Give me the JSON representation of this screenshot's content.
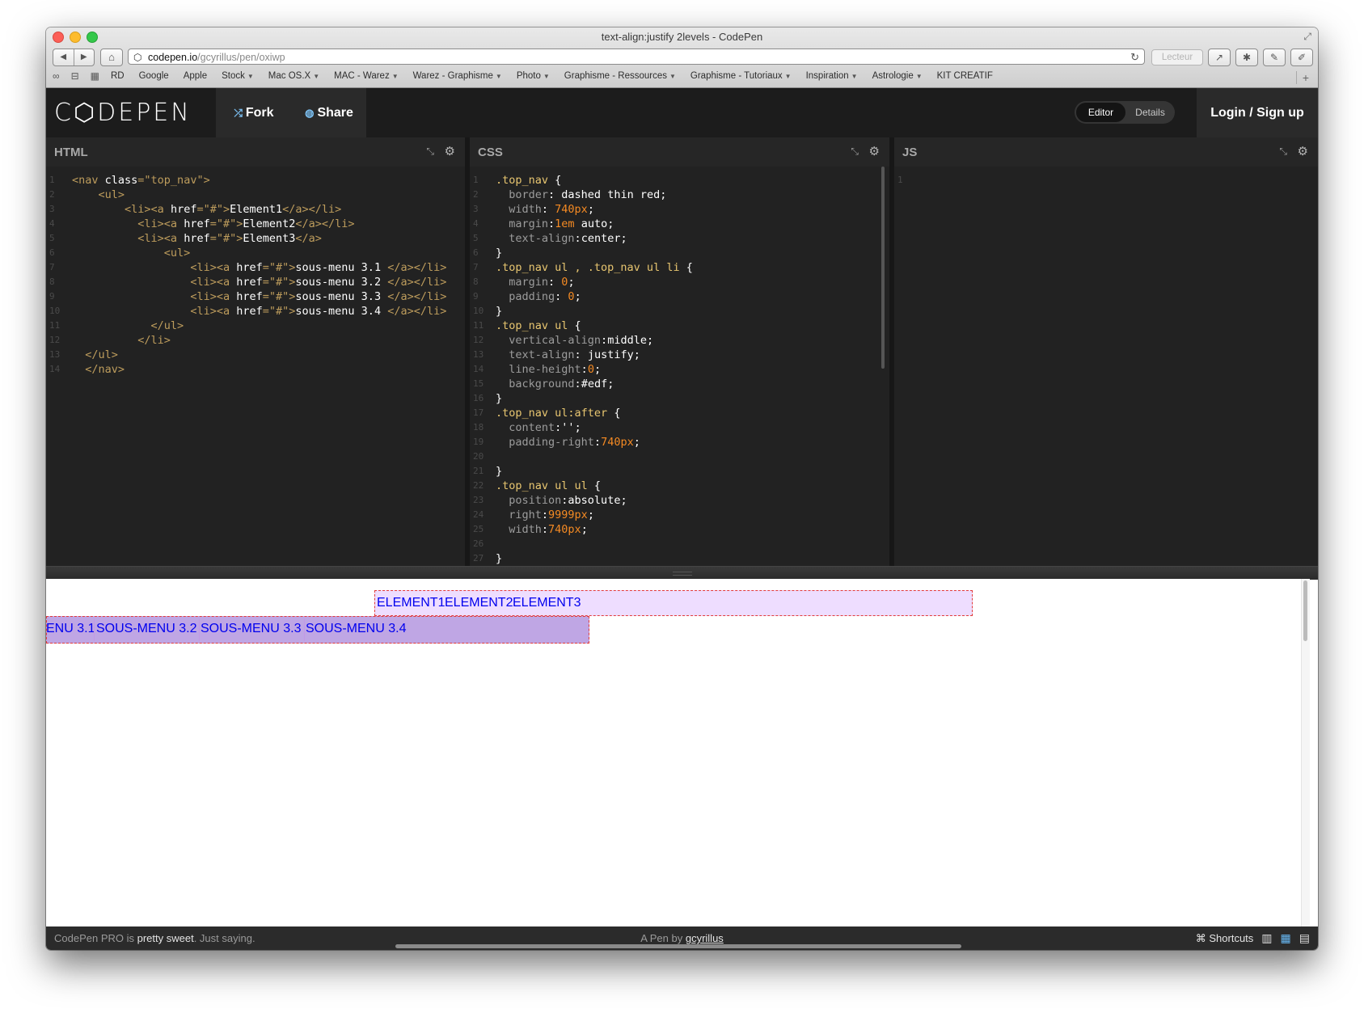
{
  "window": {
    "title": "text-align:justify 2levels - CodePen",
    "url_host": "codepen.io",
    "url_path": "/gcyrillus/pen/oxiwp",
    "reader_label": "Lecteur"
  },
  "bookmarks": [
    {
      "label": "RD"
    },
    {
      "label": "Google"
    },
    {
      "label": "Apple"
    },
    {
      "label": "Stock",
      "menu": true
    },
    {
      "label": "Mac OS.X",
      "menu": true
    },
    {
      "label": "MAC - Warez",
      "menu": true
    },
    {
      "label": "Warez - Graphisme",
      "menu": true
    },
    {
      "label": "Photo",
      "menu": true
    },
    {
      "label": "Graphisme - Ressources",
      "menu": true
    },
    {
      "label": "Graphisme - Tutoriaux",
      "menu": true
    },
    {
      "label": "Inspiration",
      "menu": true
    },
    {
      "label": "Astrologie",
      "menu": true
    },
    {
      "label": "KIT CREATIF"
    }
  ],
  "header": {
    "logo": "C⬡DEPEN",
    "fork_label": "Fork",
    "share_label": "Share",
    "editor_label": "Editor",
    "details_label": "Details",
    "login_label": "Login / Sign up"
  },
  "panes": {
    "html_title": "HTML",
    "css_title": "CSS",
    "js_title": "JS"
  },
  "html_code": [
    {
      "indent": "",
      "tokens": [
        [
          "tag",
          "<nav "
        ],
        [
          "attr",
          "class"
        ],
        [
          "tag",
          "="
        ],
        [
          "str",
          "\"top_nav\""
        ],
        [
          "tag",
          ">"
        ]
      ]
    },
    {
      "indent": "    ",
      "tokens": [
        [
          "tag",
          "<ul>"
        ]
      ]
    },
    {
      "indent": "        ",
      "tokens": [
        [
          "tag",
          "<li><a "
        ],
        [
          "attr",
          "href"
        ],
        [
          "tag",
          "="
        ],
        [
          "str",
          "\"#\""
        ],
        [
          "tag",
          ">"
        ],
        [
          "text",
          "Element1"
        ],
        [
          "tag",
          "</a></li>"
        ]
      ]
    },
    {
      "indent": "          ",
      "tokens": [
        [
          "tag",
          "<li><a "
        ],
        [
          "attr",
          "href"
        ],
        [
          "tag",
          "="
        ],
        [
          "str",
          "\"#\""
        ],
        [
          "tag",
          ">"
        ],
        [
          "text",
          "Element2"
        ],
        [
          "tag",
          "</a></li>"
        ]
      ]
    },
    {
      "indent": "          ",
      "tokens": [
        [
          "tag",
          "<li><a "
        ],
        [
          "attr",
          "href"
        ],
        [
          "tag",
          "="
        ],
        [
          "str",
          "\"#\""
        ],
        [
          "tag",
          ">"
        ],
        [
          "text",
          "Element3"
        ],
        [
          "tag",
          "</a>"
        ]
      ]
    },
    {
      "indent": "              ",
      "tokens": [
        [
          "tag",
          "<ul>"
        ]
      ]
    },
    {
      "indent": "                  ",
      "tokens": [
        [
          "tag",
          "<li><a "
        ],
        [
          "attr",
          "href"
        ],
        [
          "tag",
          "="
        ],
        [
          "str",
          "\"#\""
        ],
        [
          "tag",
          ">"
        ],
        [
          "text",
          "sous-menu 3.1 "
        ],
        [
          "tag",
          "</a></li>"
        ]
      ]
    },
    {
      "indent": "                  ",
      "tokens": [
        [
          "tag",
          "<li><a "
        ],
        [
          "attr",
          "href"
        ],
        [
          "tag",
          "="
        ],
        [
          "str",
          "\"#\""
        ],
        [
          "tag",
          ">"
        ],
        [
          "text",
          "sous-menu 3.2 "
        ],
        [
          "tag",
          "</a></li>"
        ]
      ]
    },
    {
      "indent": "                  ",
      "tokens": [
        [
          "tag",
          "<li><a "
        ],
        [
          "attr",
          "href"
        ],
        [
          "tag",
          "="
        ],
        [
          "str",
          "\"#\""
        ],
        [
          "tag",
          ">"
        ],
        [
          "text",
          "sous-menu 3.3 "
        ],
        [
          "tag",
          "</a></li>"
        ]
      ]
    },
    {
      "indent": "                  ",
      "tokens": [
        [
          "tag",
          "<li><a "
        ],
        [
          "attr",
          "href"
        ],
        [
          "tag",
          "="
        ],
        [
          "str",
          "\"#\""
        ],
        [
          "tag",
          ">"
        ],
        [
          "text",
          "sous-menu 3.4 "
        ],
        [
          "tag",
          "</a></li>"
        ]
      ]
    },
    {
      "indent": "            ",
      "tokens": [
        [
          "tag",
          "</ul>"
        ]
      ]
    },
    {
      "indent": "          ",
      "tokens": [
        [
          "tag",
          "</li>"
        ]
      ]
    },
    {
      "indent": "  ",
      "tokens": [
        [
          "tag",
          "</ul>"
        ]
      ]
    },
    {
      "indent": "  ",
      "tokens": [
        [
          "tag",
          "</nav>"
        ]
      ]
    }
  ],
  "css_code": [
    [
      [
        "sel",
        ".top_nav "
      ],
      [
        "punc",
        "{"
      ]
    ],
    [
      [
        "prop",
        "  border"
      ],
      [
        "punc",
        ": "
      ],
      [
        "val",
        "dashed thin red"
      ],
      [
        "punc",
        ";"
      ]
    ],
    [
      [
        "prop",
        "  width"
      ],
      [
        "punc",
        ": "
      ],
      [
        "num",
        "740px"
      ],
      [
        "punc",
        ";"
      ]
    ],
    [
      [
        "prop",
        "  margin"
      ],
      [
        "punc",
        ":"
      ],
      [
        "num",
        "1em"
      ],
      [
        "val",
        " auto"
      ],
      [
        "punc",
        ";"
      ]
    ],
    [
      [
        "prop",
        "  text-align"
      ],
      [
        "punc",
        ":"
      ],
      [
        "val",
        "center"
      ],
      [
        "punc",
        ";"
      ]
    ],
    [
      [
        "punc",
        "}"
      ]
    ],
    [
      [
        "sel",
        ".top_nav ul , .top_nav ul li "
      ],
      [
        "punc",
        "{"
      ]
    ],
    [
      [
        "prop",
        "  margin"
      ],
      [
        "punc",
        ": "
      ],
      [
        "num",
        "0"
      ],
      [
        "punc",
        ";"
      ]
    ],
    [
      [
        "prop",
        "  padding"
      ],
      [
        "punc",
        ": "
      ],
      [
        "num",
        "0"
      ],
      [
        "punc",
        ";"
      ]
    ],
    [
      [
        "punc",
        "}"
      ]
    ],
    [
      [
        "sel",
        ".top_nav ul "
      ],
      [
        "punc",
        "{"
      ]
    ],
    [
      [
        "prop",
        "  vertical-align"
      ],
      [
        "punc",
        ":"
      ],
      [
        "val",
        "middle"
      ],
      [
        "punc",
        ";"
      ]
    ],
    [
      [
        "prop",
        "  text-align"
      ],
      [
        "punc",
        ": "
      ],
      [
        "val",
        "justify"
      ],
      [
        "punc",
        ";"
      ]
    ],
    [
      [
        "prop",
        "  line-height"
      ],
      [
        "punc",
        ":"
      ],
      [
        "num",
        "0"
      ],
      [
        "punc",
        ";"
      ]
    ],
    [
      [
        "prop",
        "  background"
      ],
      [
        "punc",
        ":"
      ],
      [
        "val",
        "#edf"
      ],
      [
        "punc",
        ";"
      ]
    ],
    [
      [
        "punc",
        "}"
      ]
    ],
    [
      [
        "sel",
        ".top_nav ul:after "
      ],
      [
        "punc",
        "{"
      ]
    ],
    [
      [
        "prop",
        "  content"
      ],
      [
        "punc",
        ":"
      ],
      [
        "val",
        "''"
      ],
      [
        "punc",
        ";"
      ]
    ],
    [
      [
        "prop",
        "  padding-right"
      ],
      [
        "punc",
        ":"
      ],
      [
        "num",
        "740px"
      ],
      [
        "punc",
        ";"
      ]
    ],
    [],
    [
      [
        "punc",
        "}"
      ]
    ],
    [
      [
        "sel",
        ".top_nav ul ul "
      ],
      [
        "punc",
        "{"
      ]
    ],
    [
      [
        "prop",
        "  position"
      ],
      [
        "punc",
        ":"
      ],
      [
        "val",
        "absolute"
      ],
      [
        "punc",
        ";"
      ]
    ],
    [
      [
        "prop",
        "  right"
      ],
      [
        "punc",
        ":"
      ],
      [
        "num",
        "9999px"
      ],
      [
        "punc",
        ";"
      ]
    ],
    [
      [
        "prop",
        "  width"
      ],
      [
        "punc",
        ":"
      ],
      [
        "num",
        "740px"
      ],
      [
        "punc",
        ";"
      ]
    ],
    [],
    [
      [
        "punc",
        "}"
      ]
    ]
  ],
  "js_code": [
    ""
  ],
  "preview": {
    "top_items": [
      "ELEMENT1",
      "ELEMENT2",
      "ELEMENT3"
    ],
    "sub_items": [
      "ENU 3.1",
      "SOUS-MENU 3.2",
      "SOUS-MENU 3.3",
      "SOUS-MENU 3.4"
    ]
  },
  "footer": {
    "promo_prefix": "CodePen PRO is ",
    "promo_bold": "pretty sweet",
    "promo_suffix": ". Just saying.",
    "pen_by_prefix": "A Pen by ",
    "author": "gcyrillus",
    "shortcuts_label": "⌘ Shortcuts"
  },
  "colors": {
    "preview_nav_bg": "#eeddff",
    "preview_sub_bg": "#bfa6e4",
    "preview_border": "#e23b3b",
    "link": "#0000ee"
  }
}
